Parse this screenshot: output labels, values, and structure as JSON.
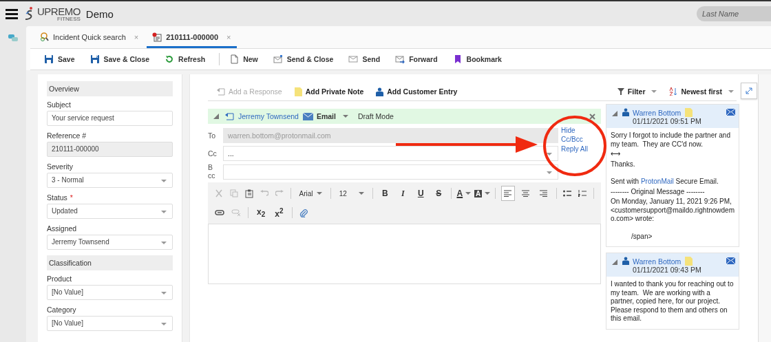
{
  "app": {
    "brand": "UPREMO",
    "brand_sub": "FITNESS",
    "title": "Demo"
  },
  "search": {
    "placeholder": "Last Name"
  },
  "tabs": [
    {
      "label": "Incident Quick search",
      "selected": false,
      "close": "×"
    },
    {
      "label": "210111-000000",
      "selected": true,
      "close": "×"
    }
  ],
  "toolbar": [
    {
      "label": "Save"
    },
    {
      "label": "Save & Close"
    },
    {
      "label": "Refresh"
    },
    {
      "label": "New"
    },
    {
      "label": "Send & Close"
    },
    {
      "label": "Send"
    },
    {
      "label": "Forward"
    },
    {
      "label": "Bookmark"
    }
  ],
  "form": [
    {
      "kind": "section",
      "label": "Overview"
    },
    {
      "kind": "text",
      "label": "Subject",
      "value": "Your service request"
    },
    {
      "kind": "readonly",
      "label": "Reference #",
      "value": "210111-000000"
    },
    {
      "kind": "select",
      "label": "Severity",
      "value": "3 - Normal"
    },
    {
      "kind": "select",
      "label": "Status",
      "value": "Updated",
      "required": "*"
    },
    {
      "kind": "select",
      "label": "Assigned",
      "value": "Jerremy Townsend"
    },
    {
      "kind": "section",
      "label": "Classification"
    },
    {
      "kind": "select",
      "label": "Product",
      "value": "[No Value]"
    },
    {
      "kind": "select",
      "label": "Category",
      "value": "[No Value]"
    }
  ],
  "actions": [
    {
      "label": "Add a Response",
      "disabled": true
    },
    {
      "label": "Add Private Note",
      "disabled": false
    },
    {
      "label": "Add Customer Entry",
      "disabled": false
    }
  ],
  "filter": "Filter",
  "sort": "Newest first",
  "composer": {
    "author": "Jerremy Townsend",
    "channel": "Email",
    "mode": "Draft Mode",
    "to_label": "To",
    "to": "warren.bottom@protonmail.com",
    "cc_label": "Cc",
    "cc": "...",
    "bcc_label": "Bcc",
    "links": [
      "Hide Cc/Bcc",
      "Reply All"
    ],
    "editor": {
      "font": "Arial",
      "size": "12",
      "styles": [
        "B",
        "I",
        "U",
        "S"
      ],
      "colors": [
        "A",
        "A"
      ],
      "alignments": [
        {
          "selected": true
        },
        {
          "selected": false
        },
        {
          "selected": false
        }
      ],
      "scripts": [
        "x$_{2}$",
        "x$^{2}$"
      ]
    }
  },
  "annotation": {
    "shown": true
  },
  "thread": [
    {
      "author": "Warren Bottom",
      "time": "01/11/2021 09:51 PM",
      "paragraphs": [
        {
          "parts": [
            {
              "text": "Sorry I forgot to include the partner and my team.  They are CC'd now."
            }
          ]
        },
        {
          "parts": [
            {
              "text": "⟷"
            }
          ]
        },
        {
          "parts": [
            {
              "text": "Thanks."
            }
          ]
        },
        {
          "space_before": true,
          "parts": [
            {
              "text": "Sent with "
            },
            {
              "text": "ProtonMail",
              "link": true
            },
            {
              "text": " Secure Email."
            }
          ]
        },
        {
          "parts": [
            {
              "text": "-------- Original Message --------"
            }
          ]
        },
        {
          "parts": [
            {
              "text": "On Monday, January 11, 2021 9:26 PM, <customersupport@maildo.rightnowdemo.com> wrote:"
            }
          ]
        },
        {
          "space_before": true,
          "indent": true,
          "parts": [
            {
              "text": "/span>"
            }
          ]
        }
      ]
    },
    {
      "author": "Warren Bottom",
      "time": "01/11/2021 09:43 PM",
      "paragraphs": [
        {
          "parts": [
            {
              "text": "I wanted to thank you for reaching out to my team.  We are working with a partner, copied here, for our project. Please respond to them and others on this email."
            }
          ]
        }
      ]
    }
  ]
}
